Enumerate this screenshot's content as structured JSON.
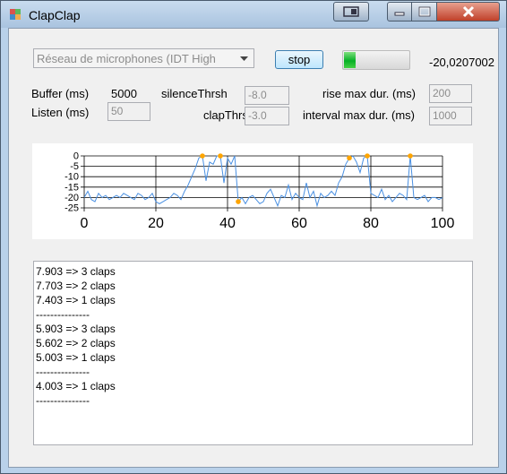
{
  "window": {
    "title": "ClapClap"
  },
  "device": {
    "selected": "Réseau de microphones (IDT High"
  },
  "controls": {
    "stop_label": "stop",
    "level_value": "-20,0207002",
    "level_fill_fraction": 0.18
  },
  "params": {
    "buffer_label": "Buffer (ms)",
    "buffer_value": "5000",
    "listen_label": "Listen (ms)",
    "listen_value": "50",
    "silence_label": "silenceThrsh",
    "silence_value": "-8.0",
    "clap_label": "clapThrsh",
    "clap_value": "-3.0",
    "rise_label": "rise max dur. (ms)",
    "rise_value": "200",
    "interval_label": "interval max dur. (ms)",
    "interval_value": "1000"
  },
  "chart_data": {
    "type": "line",
    "xlim": [
      0,
      100
    ],
    "ylim": [
      -25,
      0
    ],
    "x_ticks": [
      "0",
      "20",
      "40",
      "60",
      "80",
      "100"
    ],
    "y_ticks": [
      "0",
      "-5",
      "-10",
      "-15",
      "-20",
      "-25"
    ],
    "grid": true,
    "line_color": "#4a90e2",
    "marker_color": "#ffa500",
    "series": [
      {
        "values": [
          -20,
          -17,
          -21,
          -22,
          -18,
          -20,
          -19,
          -21,
          -20,
          -19,
          -20,
          -18,
          -19,
          -20,
          -21,
          -18,
          -19,
          -21,
          -20,
          -18,
          -22,
          -23,
          -22,
          -21,
          -20,
          -18,
          -19,
          -21,
          -17,
          -14,
          -10,
          -6,
          -1,
          0,
          -12,
          -3,
          -4,
          0,
          0,
          -13,
          -1,
          -4,
          0,
          -22,
          -20,
          -23,
          -20,
          -19,
          -21,
          -23,
          -22,
          -18,
          -16,
          -20,
          -24,
          -19,
          -20,
          -14,
          -21,
          -18,
          -20,
          -21,
          -13,
          -20,
          -17,
          -24,
          -18,
          -20,
          -19,
          -17,
          -19,
          -13,
          -10,
          -4,
          -1,
          0,
          -3,
          -8,
          -1,
          0,
          -18,
          -19,
          -20,
          -16,
          -21,
          -19,
          -22,
          -20,
          -18,
          -19,
          -21,
          0,
          -20,
          -21,
          -20,
          -19,
          -22,
          -20,
          -20,
          -21,
          -20
        ],
        "peaks_x": [
          33,
          38,
          43,
          74,
          79,
          91
        ]
      }
    ]
  },
  "log": {
    "lines": [
      "7.903 => 3 claps",
      "7.703 => 2 claps",
      "7.403 => 1 claps",
      "---------------",
      "5.903 => 3 claps",
      "5.602 => 2 claps",
      "5.003 => 1 claps",
      "---------------",
      "4.003 => 1 claps",
      "---------------"
    ]
  }
}
